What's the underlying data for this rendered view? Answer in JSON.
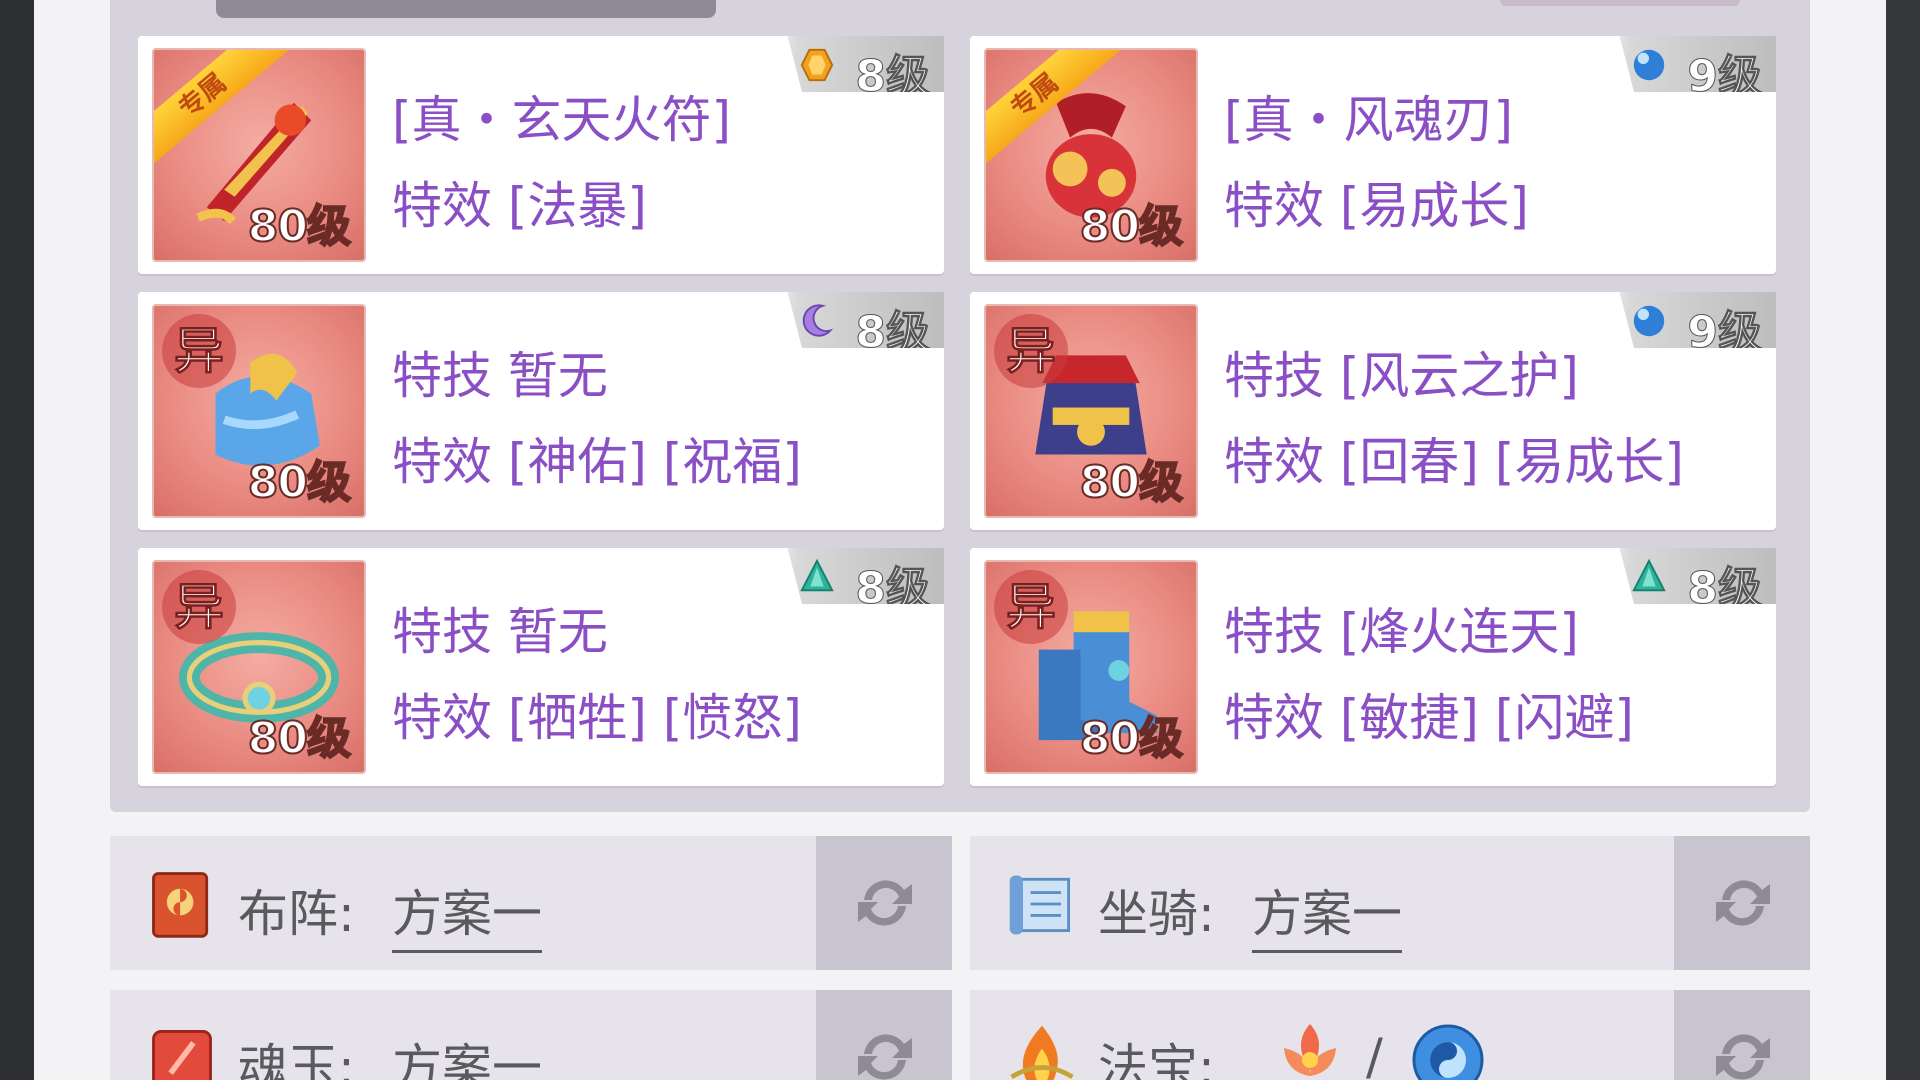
{
  "equipment": [
    {
      "tag": "专属",
      "title": "[真・玄天火符]",
      "effect_label": "特效",
      "effect_value": "[法暴]",
      "level": "80级",
      "gem_level": "8级",
      "gem": "amber-gem",
      "art": "fire-talisman"
    },
    {
      "tag": "专属",
      "title": "[真・风魂刃]",
      "effect_label": "特效",
      "effect_value": "[易成长]",
      "level": "80级",
      "gem_level": "9级",
      "gem": "blue-orb",
      "art": "wind-blade"
    },
    {
      "tag": "异",
      "skill_label": "特技",
      "skill_value": "暂无",
      "effect_label": "特效",
      "effect_value": "[神佑] [祝福]",
      "level": "80级",
      "gem_level": "8级",
      "gem": "moon-gem",
      "art": "blue-robe"
    },
    {
      "tag": "异",
      "skill_label": "特技",
      "skill_value": "[风云之护]",
      "effect_label": "特效",
      "effect_value": "[回春] [易成长]",
      "level": "80级",
      "gem_level": "9级",
      "gem": "blue-orb",
      "art": "gold-armor"
    },
    {
      "tag": "异",
      "skill_label": "特技",
      "skill_value": "暂无",
      "effect_label": "特效",
      "effect_value": "[牺牲] [愤怒]",
      "level": "80级",
      "gem_level": "8级",
      "gem": "teal-gem",
      "art": "jade-belt"
    },
    {
      "tag": "异",
      "skill_label": "特技",
      "skill_value": "[烽火连天]",
      "effect_label": "特效",
      "effect_value": "[敏捷] [闪避]",
      "level": "80级",
      "gem_level": "8级",
      "gem": "teal-gem",
      "art": "blue-boots"
    }
  ],
  "plans": {
    "formation": {
      "label": "布阵:",
      "value": "方案一",
      "icon": "formation-book-icon"
    },
    "mount": {
      "label": "坐骑:",
      "value": "方案一",
      "icon": "scroll-icon"
    },
    "soul_jade": {
      "label": "魂玉:",
      "value": "方案一",
      "icon": "soul-jade-icon"
    },
    "treasure": {
      "label": "法宝:",
      "separator": "/",
      "icon": "flame-treasure-icon"
    }
  },
  "colors": {
    "purple_text": "#8a4fc4",
    "panel": "#d6d3dc",
    "card": "#ffffff",
    "thumb": "#ea8c83"
  }
}
